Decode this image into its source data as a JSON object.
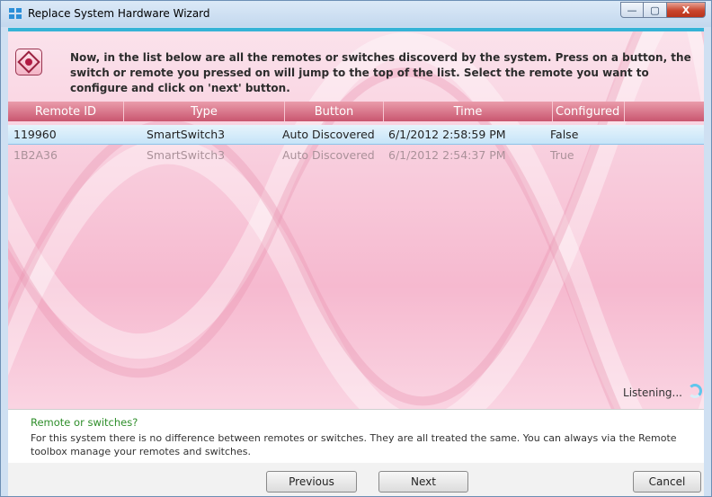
{
  "window": {
    "title": "Replace System Hardware Wizard",
    "controls": {
      "minimize": "—",
      "maximize": "▢",
      "close": "X"
    }
  },
  "header": {
    "icon": "remote-control-icon",
    "instruction": "Now, in the list below are all the remotes or switches discoverd by the system. Press on a button, the switch or remote you pressed on will jump to the top of the list. Select the remote you want to configure and click on 'next' button."
  },
  "table": {
    "columns": [
      "Remote ID",
      "Type",
      "Button",
      "Time",
      "Configured"
    ],
    "rows": [
      {
        "remote_id": "119960",
        "type": "SmartSwitch3",
        "button": "Auto Discovered",
        "time": "6/1/2012 2:58:59 PM",
        "configured": "False"
      },
      {
        "remote_id": "1B2A36",
        "type": "SmartSwitch3",
        "button": "Auto Discovered",
        "time": "6/1/2012 2:54:37 PM",
        "configured": "True"
      }
    ]
  },
  "status": {
    "listening": "Listening..."
  },
  "hint": {
    "title": "Remote or switches?",
    "text": "For this system there is no difference between remotes or switches. They are all treated the same. You can always via the Remote toolbox manage your remotes and switches."
  },
  "footer": {
    "previous": "Previous",
    "next": "Next",
    "cancel": "Cancel"
  },
  "colors": {
    "accent_bar": "#35b3d6",
    "header_pink": "#d8677f",
    "hint_green": "#2e8e2a",
    "selection": "#c6e4f8"
  }
}
